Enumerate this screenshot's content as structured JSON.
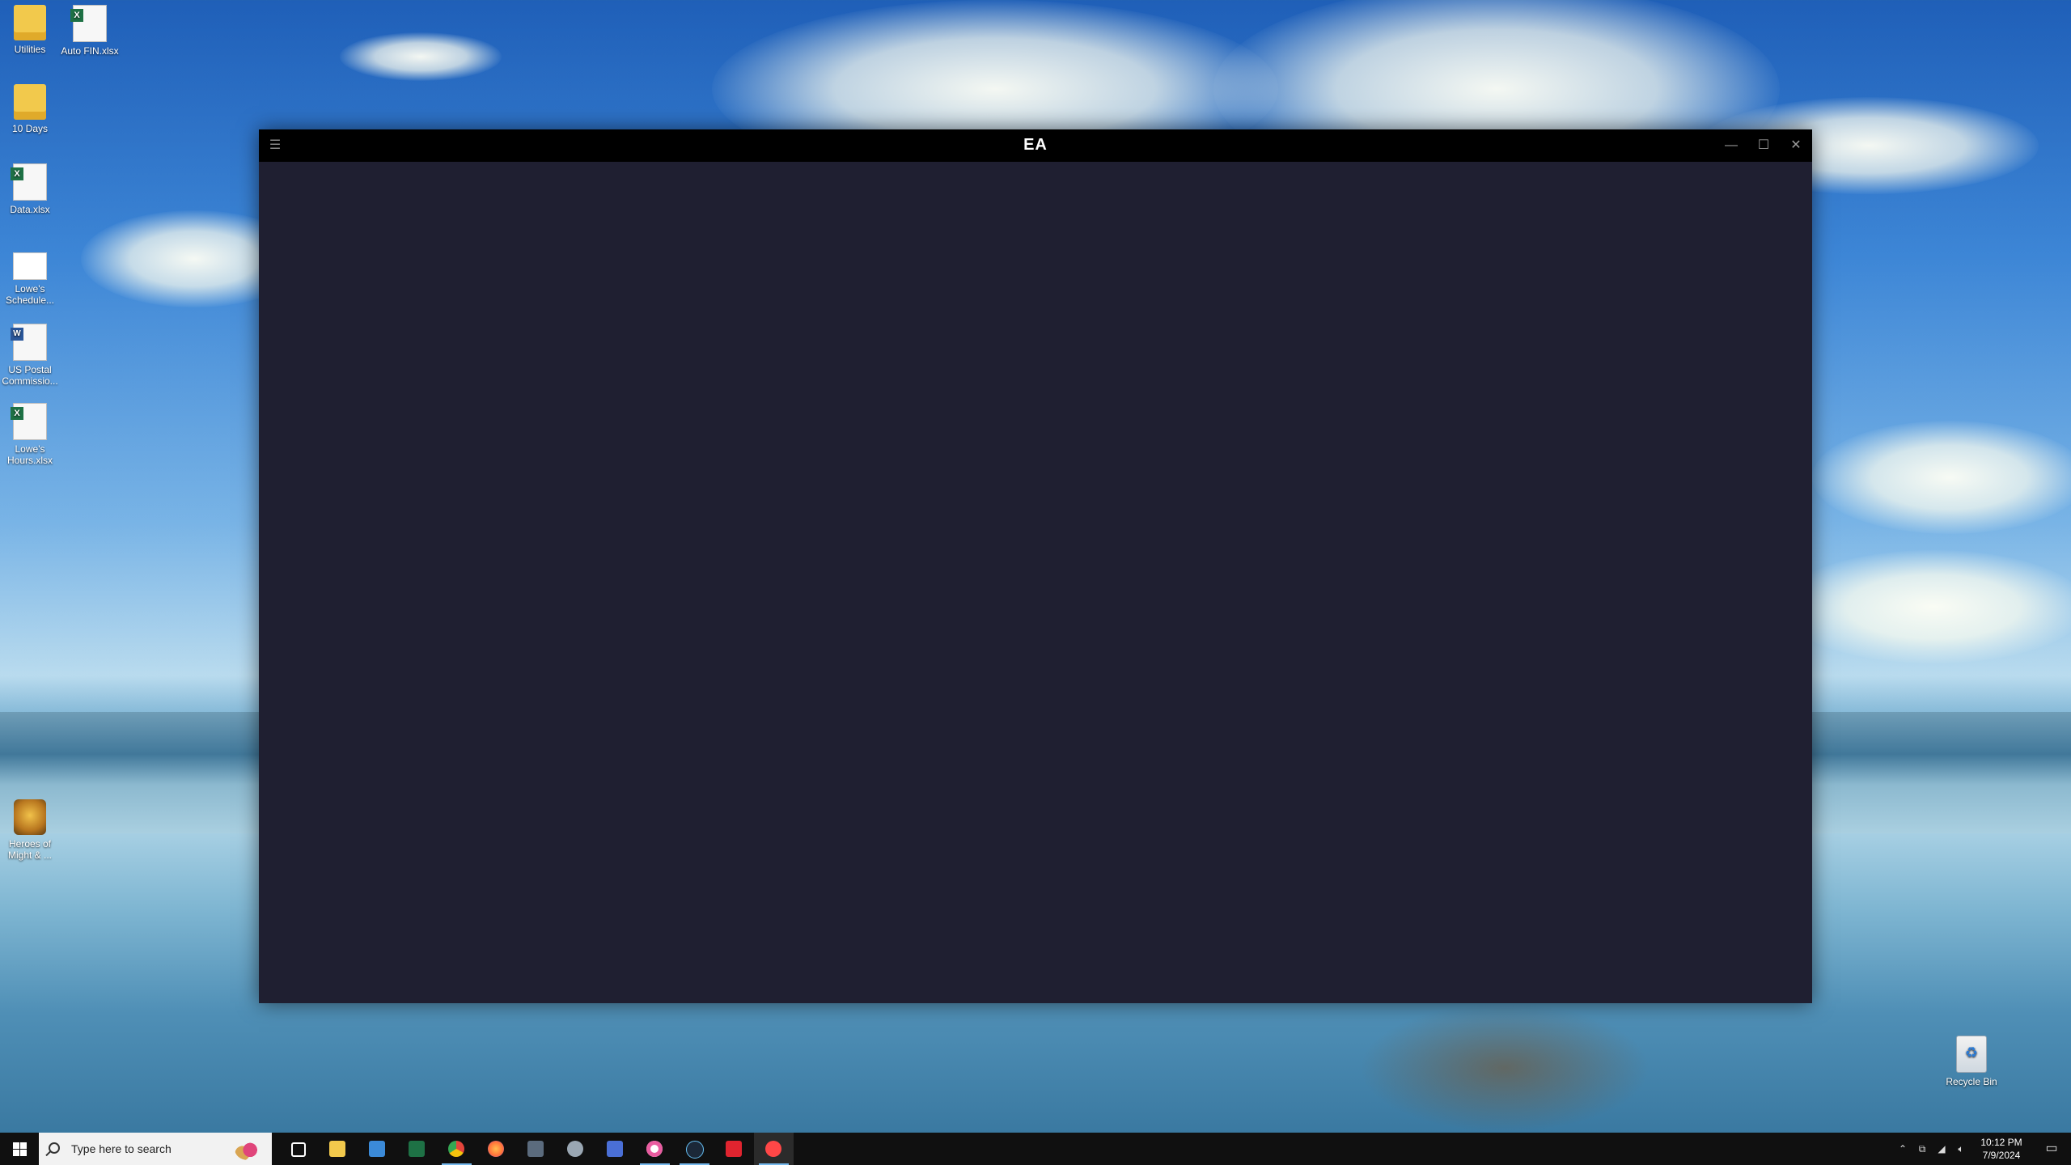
{
  "desktop": {
    "icons": [
      {
        "label": "Utilities"
      },
      {
        "label": "Auto FIN.xlsx"
      },
      {
        "label": "10 Days"
      },
      {
        "label": "Data.xlsx"
      },
      {
        "label": "Lowe's Schedule..."
      },
      {
        "label": "US Postal Commissio..."
      },
      {
        "label": "Lowe's Hours.xlsx"
      },
      {
        "label": "Heroes of Might & ..."
      }
    ],
    "recycle_bin": {
      "label": "Recycle Bin"
    }
  },
  "ea_window": {
    "logo": "EA",
    "menu_icon": "hamburger-icon",
    "controls": {
      "minimize": "—",
      "maximize": "☐",
      "close": "✕"
    }
  },
  "taskbar": {
    "search_placeholder": "Type here to search",
    "apps": [
      {
        "name": "task-view-icon",
        "color": "#ffffff"
      },
      {
        "name": "file-explorer-icon",
        "color": "#f2c94c"
      },
      {
        "name": "microsoft-store-icon",
        "color": "#3b8ad8"
      },
      {
        "name": "excel-icon",
        "color": "#1e7145"
      },
      {
        "name": "chrome-icon",
        "color": "#e5453b"
      },
      {
        "name": "firefox-icon",
        "color": "#ff7139"
      },
      {
        "name": "calculator-icon",
        "color": "#5b6b7d"
      },
      {
        "name": "settings-app-icon",
        "color": "#9aa7b3"
      },
      {
        "name": "app-icon",
        "color": "#4a6fd6"
      },
      {
        "name": "itunes-icon",
        "color": "#e95ca0"
      },
      {
        "name": "steam-icon",
        "color": "#1b2838"
      },
      {
        "name": "app-red-icon",
        "color": "#e0242f"
      },
      {
        "name": "ea-app-icon",
        "color": "#ff4747"
      }
    ],
    "clock": {
      "time": "10:12 PM",
      "date": "7/9/2024"
    }
  }
}
